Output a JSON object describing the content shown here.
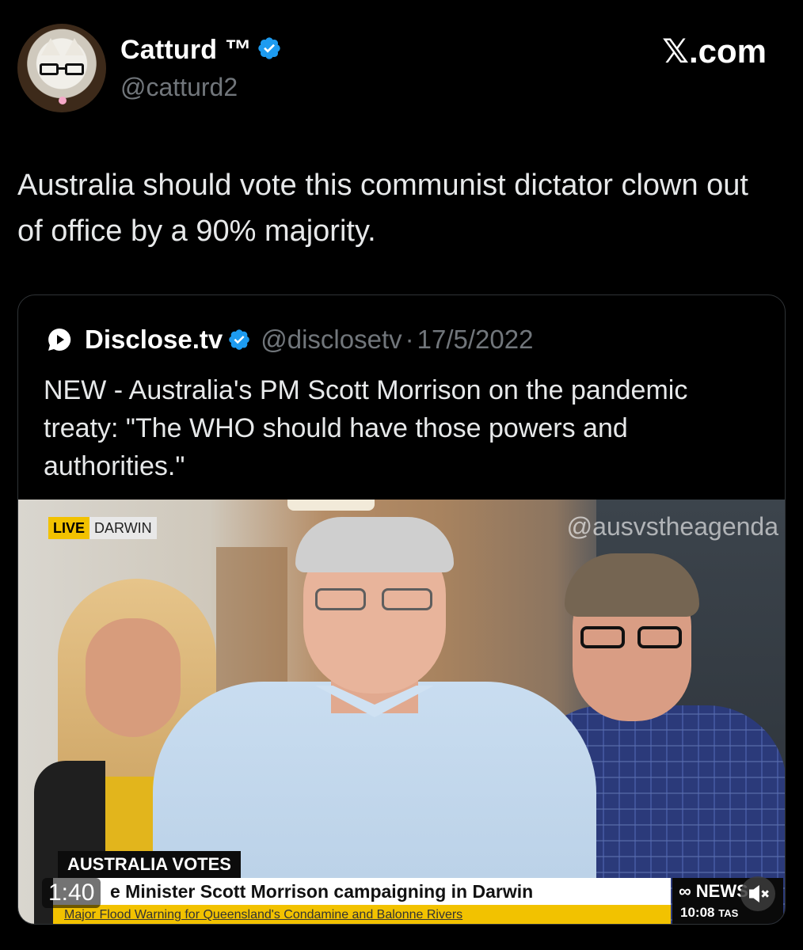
{
  "post": {
    "author_name": "Catturd ™",
    "handle": "@catturd2",
    "verified": true,
    "site_label": "com",
    "text": "Australia should vote this communist dictator clown out of office by a 90% majority."
  },
  "quoted": {
    "author_name": "Disclose.tv",
    "handle": "@disclosetv",
    "separator": "·",
    "date": "17/5/2022",
    "text": "NEW - Australia's PM Scott Morrison on the pandemic treaty: \"The WHO should have those powers and authorities.\""
  },
  "video": {
    "live_label": "LIVE",
    "location": "DARWIN",
    "watermark": "@ausvstheagenda",
    "banner_title": "AUSTRALIA VOTES",
    "ticker_main": "e Minister Scott Morrison campaigning in Darwin",
    "ticker_sub": "Major Flood Warning for Queensland's Condamine and Balonne Rivers",
    "elapsed": "1:40",
    "channel_logo": "NEWS",
    "channel_time": "10:08",
    "channel_tz": "TAS"
  },
  "colors": {
    "background": "#000000",
    "verified_blue": "#1d9bf0",
    "muted_text": "#71767b",
    "border": "#2f3336",
    "live_yellow": "#f2c200"
  },
  "icons": {
    "verified": "verified-badge-icon",
    "quoted_avatar": "disclose-logo-icon",
    "mute": "mute-icon"
  }
}
